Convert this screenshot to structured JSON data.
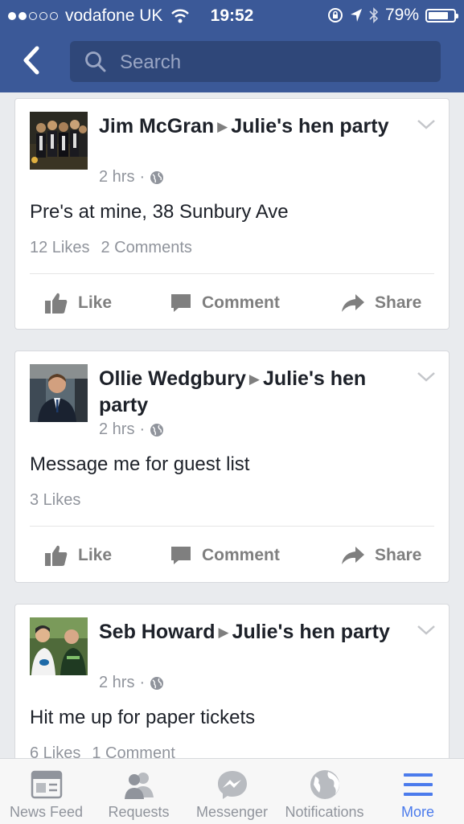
{
  "status_bar": {
    "carrier": "vodafone UK",
    "time": "19:52",
    "battery": "79%",
    "battery_level": 0.79
  },
  "search": {
    "placeholder": "Search"
  },
  "posts": [
    {
      "author": "Jim McGran",
      "group": "Julie's hen party",
      "time": "2 hrs",
      "text": "Pre's at mine, 38 Sunbury Ave",
      "likes": "12 Likes",
      "comments": "2 Comments"
    },
    {
      "author": "Ollie Wedgbury",
      "group": "Julie's hen party",
      "time": "2 hrs",
      "text": "Message me for guest list",
      "likes": "3 Likes",
      "comments": ""
    },
    {
      "author": "Seb Howard",
      "group": "Julie's hen party",
      "time": "2 hrs",
      "text": "Hit me up for paper tickets",
      "likes": "6 Likes",
      "comments": "1 Comment"
    }
  ],
  "actions": {
    "like": "Like",
    "comment": "Comment",
    "share": "Share"
  },
  "tabs": [
    {
      "label": "News Feed",
      "icon": "news-feed-icon"
    },
    {
      "label": "Requests",
      "icon": "friend-requests-icon"
    },
    {
      "label": "Messenger",
      "icon": "messenger-icon"
    },
    {
      "label": "Notifications",
      "icon": "globe-icon"
    },
    {
      "label": "More",
      "icon": "menu-icon",
      "active": true
    }
  ],
  "colors": {
    "brand": "#3b5998",
    "active_tab": "#4b7bec",
    "muted": "#90949c"
  }
}
